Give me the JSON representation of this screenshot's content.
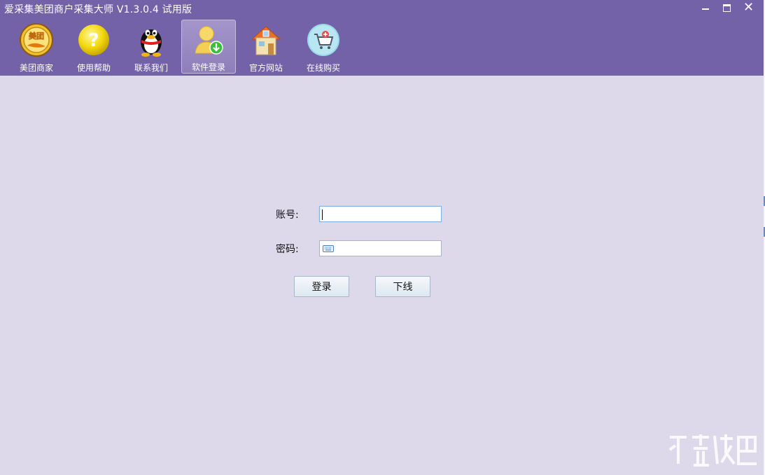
{
  "window": {
    "title": "爱采集美团商户采集大师 V1.3.0.4 试用版",
    "controls": {
      "minimize": "minimize",
      "maximize": "maximize",
      "close": "close"
    }
  },
  "toolbar": {
    "items": [
      {
        "label": "美团商家",
        "icon": "meituan-icon",
        "active": false
      },
      {
        "label": "使用帮助",
        "icon": "help-icon",
        "active": false
      },
      {
        "label": "联系我们",
        "icon": "qq-penguin-icon",
        "active": false
      },
      {
        "label": "软件登录",
        "icon": "user-login-icon",
        "active": true
      },
      {
        "label": "官方网站",
        "icon": "home-icon",
        "active": false
      },
      {
        "label": "在线购买",
        "icon": "cart-icon",
        "active": false
      }
    ],
    "meituan_badge_text": "美团"
  },
  "login": {
    "account_label": "账号:",
    "account_value": "",
    "password_label": "密码:",
    "password_value": "",
    "login_button": "登录",
    "logout_button": "下线"
  },
  "colors": {
    "titlebar": "#7362a8",
    "body": "#ded9ea",
    "active_tool": "#9a8cc4"
  }
}
